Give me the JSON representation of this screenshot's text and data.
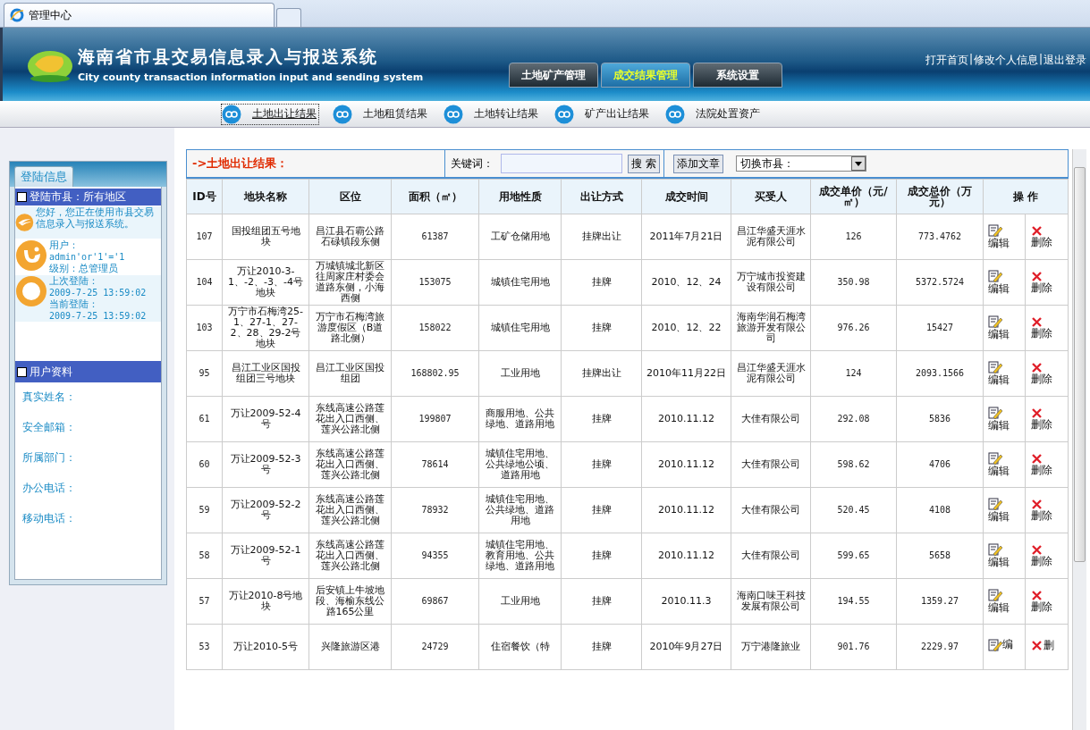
{
  "browser_tab": {
    "title": "管理中心"
  },
  "header": {
    "title": "海南省市县交易信息录入与报送系统",
    "subtitle": "City county transaction information input and sending system",
    "tabs": [
      {
        "label": "土地矿产管理",
        "selected": false
      },
      {
        "label": "成交结果管理",
        "selected": true
      },
      {
        "label": "系统设置",
        "selected": false
      }
    ],
    "links": [
      "打开首页",
      "修改个人信息",
      "退出登录"
    ],
    "separator": "|"
  },
  "subnav": [
    {
      "label": "土地出让结果",
      "selected": true
    },
    {
      "label": "土地租赁结果",
      "selected": false
    },
    {
      "label": "土地转让结果",
      "selected": false
    },
    {
      "label": "矿产出让结果",
      "selected": false
    },
    {
      "label": "法院处置资产",
      "selected": false
    }
  ],
  "sidebar": {
    "tab": "登陆信息",
    "login_section": {
      "title": "登陆市县：所有地区",
      "greeting": "您好，您正在使用市县交易信息录入与报送系统。",
      "user_label": "用户：",
      "user": "admin'or'1'='1",
      "level": "级别：总管理员",
      "last_login_label": "上次登陆：",
      "last_login": "2009-7-25 13:59:02",
      "current_login_label": "当前登陆：",
      "current_login": "2009-7-25 13:59:02"
    },
    "profile_section": {
      "title": "用户资料",
      "fields": [
        "真实姓名：",
        "安全邮箱：",
        "所属部门：",
        "办公电话：",
        "移动电话："
      ]
    }
  },
  "toolbar": {
    "title": "->土地出让结果：",
    "keyword_label": "关键词：",
    "search_button": "搜 索",
    "add_button": "添加文章",
    "county_select": "切换市县："
  },
  "table": {
    "columns": [
      "ID号",
      "地块名称",
      "区位",
      "面积（㎡）",
      "用地性质",
      "出让方式",
      "成交时间",
      "买受人",
      "成交单价（元/㎡）",
      "成交总价（万元）",
      "操 作"
    ],
    "rows": [
      {
        "id": "107",
        "name": "国投组团五号地块",
        "location": "昌江县石霸公路石碌镇段东侧",
        "area": "61387",
        "use": "工矿仓储用地",
        "method": "挂牌出让",
        "date": "2011年7月21日",
        "buyer": "昌江华盛天涯水泥有限公司",
        "unit_price": "126",
        "total_price": "773.4762",
        "edit": "编辑",
        "delete": "删除"
      },
      {
        "id": "104",
        "name": "万让2010-3-1、-2、-3、-4号地块",
        "location": "万城镇城北新区往周家庄村委会道路东侧，小海西侧",
        "area": "153075",
        "use": "城镇住宅用地",
        "method": "挂牌",
        "date": "2010、12、24",
        "buyer": "万宁城市投资建设有限公司",
        "unit_price": "350.98",
        "total_price": "5372.5724",
        "edit": "编辑",
        "delete": "删除"
      },
      {
        "id": "103",
        "name": "万宁市石梅湾25-1、27-1、27-2、28、29-2号地块",
        "location": "万宁市石梅湾旅游度假区（B道路北侧）",
        "area": "158022",
        "use": "城镇住宅用地",
        "method": "挂牌",
        "date": "2010、12、22",
        "buyer": "海南华润石梅湾旅游开发有限公司",
        "unit_price": "976.26",
        "total_price": "15427",
        "edit": "编辑",
        "delete": "删除"
      },
      {
        "id": "95",
        "name": "昌江工业区国投组团三号地块",
        "location": "昌江工业区国投组团",
        "area": "168802.95",
        "use": "工业用地",
        "method": "挂牌出让",
        "date": "2010年11月22日",
        "buyer": "昌江华盛天涯水泥有限公司",
        "unit_price": "124",
        "total_price": "2093.1566",
        "edit": "编辑",
        "delete": "删除"
      },
      {
        "id": "61",
        "name": "万让2009-52-4号",
        "location": "东线高速公路莲花出入口西侧、莲兴公路北侧",
        "area": "199807",
        "use": "商服用地、公共绿地、道路用地",
        "method": "挂牌",
        "date": "2010.11.12",
        "buyer": "大佳有限公司",
        "unit_price": "292.08",
        "total_price": "5836",
        "edit": "编辑",
        "delete": "删除"
      },
      {
        "id": "60",
        "name": "万让2009-52-3号",
        "location": "东线高速公路莲花出入口西侧、莲兴公路北侧",
        "area": "78614",
        "use": "城镇住宅用地、公共绿地公顷、道路用地",
        "method": "挂牌",
        "date": "2010.11.12",
        "buyer": "大佳有限公司",
        "unit_price": "598.62",
        "total_price": "4706",
        "edit": "编辑",
        "delete": "删除"
      },
      {
        "id": "59",
        "name": "万让2009-52-2号",
        "location": "东线高速公路莲花出入口西侧、莲兴公路北侧",
        "area": "78932",
        "use": "城镇住宅用地、公共绿地、道路用地",
        "method": "挂牌",
        "date": "2010.11.12",
        "buyer": "大佳有限公司",
        "unit_price": "520.45",
        "total_price": "4108",
        "edit": "编辑",
        "delete": "删除"
      },
      {
        "id": "58",
        "name": "万让2009-52-1号",
        "location": "东线高速公路莲花出入口西侧、莲兴公路北侧",
        "area": "94355",
        "use": "城镇住宅用地、教育用地、公共绿地、道路用地",
        "method": "挂牌",
        "date": "2010.11.12",
        "buyer": "大佳有限公司",
        "unit_price": "599.65",
        "total_price": "5658",
        "edit": "编辑",
        "delete": "删除"
      },
      {
        "id": "57",
        "name": "万让2010-8号地块",
        "location": "后安镇上牛坡地段、海榆东线公路165公里",
        "area": "69867",
        "use": "工业用地",
        "method": "挂牌",
        "date": "2010.11.3",
        "buyer": "海南口味王科技发展有限公司",
        "unit_price": "194.55",
        "total_price": "1359.27",
        "edit": "编辑",
        "delete": "删除"
      },
      {
        "id": "53",
        "name": "万让2010-5号",
        "location": "兴隆旅游区港",
        "area": "24729",
        "use": "住宿餐饮（特",
        "method": "挂牌",
        "date": "2010年9月27日",
        "buyer": "万宁港隆旅业",
        "unit_price": "901.76",
        "total_price": "2229.97",
        "edit": "编",
        "delete": "删"
      }
    ]
  }
}
